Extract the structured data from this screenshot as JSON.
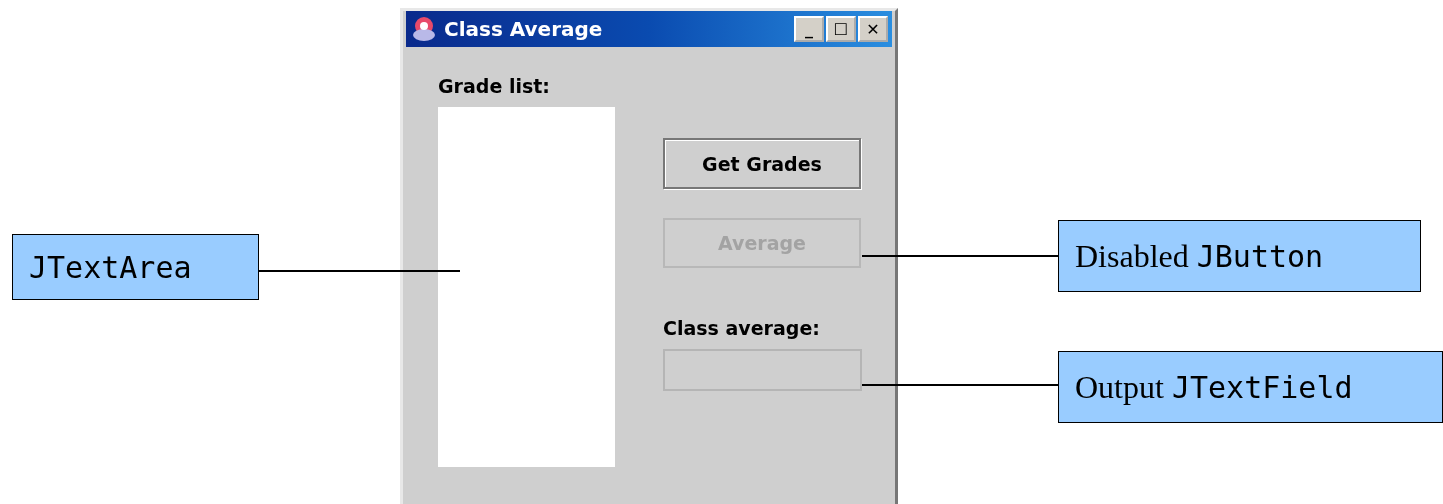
{
  "window": {
    "title": "Class Average"
  },
  "title_buttons": [
    "_",
    "☐",
    "✕"
  ],
  "grade_list": {
    "label": "Grade list:"
  },
  "buttons": [
    {
      "label": "Get Grades",
      "disabled": false
    },
    {
      "label": "Average",
      "disabled": true
    }
  ],
  "class_average": {
    "label": "Class average:"
  },
  "callouts": [
    {
      "code": "JTextArea",
      "kind": "text_area"
    },
    {
      "prefix": "Disabled ",
      "code": "JButton",
      "kind": "button"
    },
    {
      "prefix": "Output ",
      "code": "JTextField",
      "kind": "field"
    }
  ]
}
